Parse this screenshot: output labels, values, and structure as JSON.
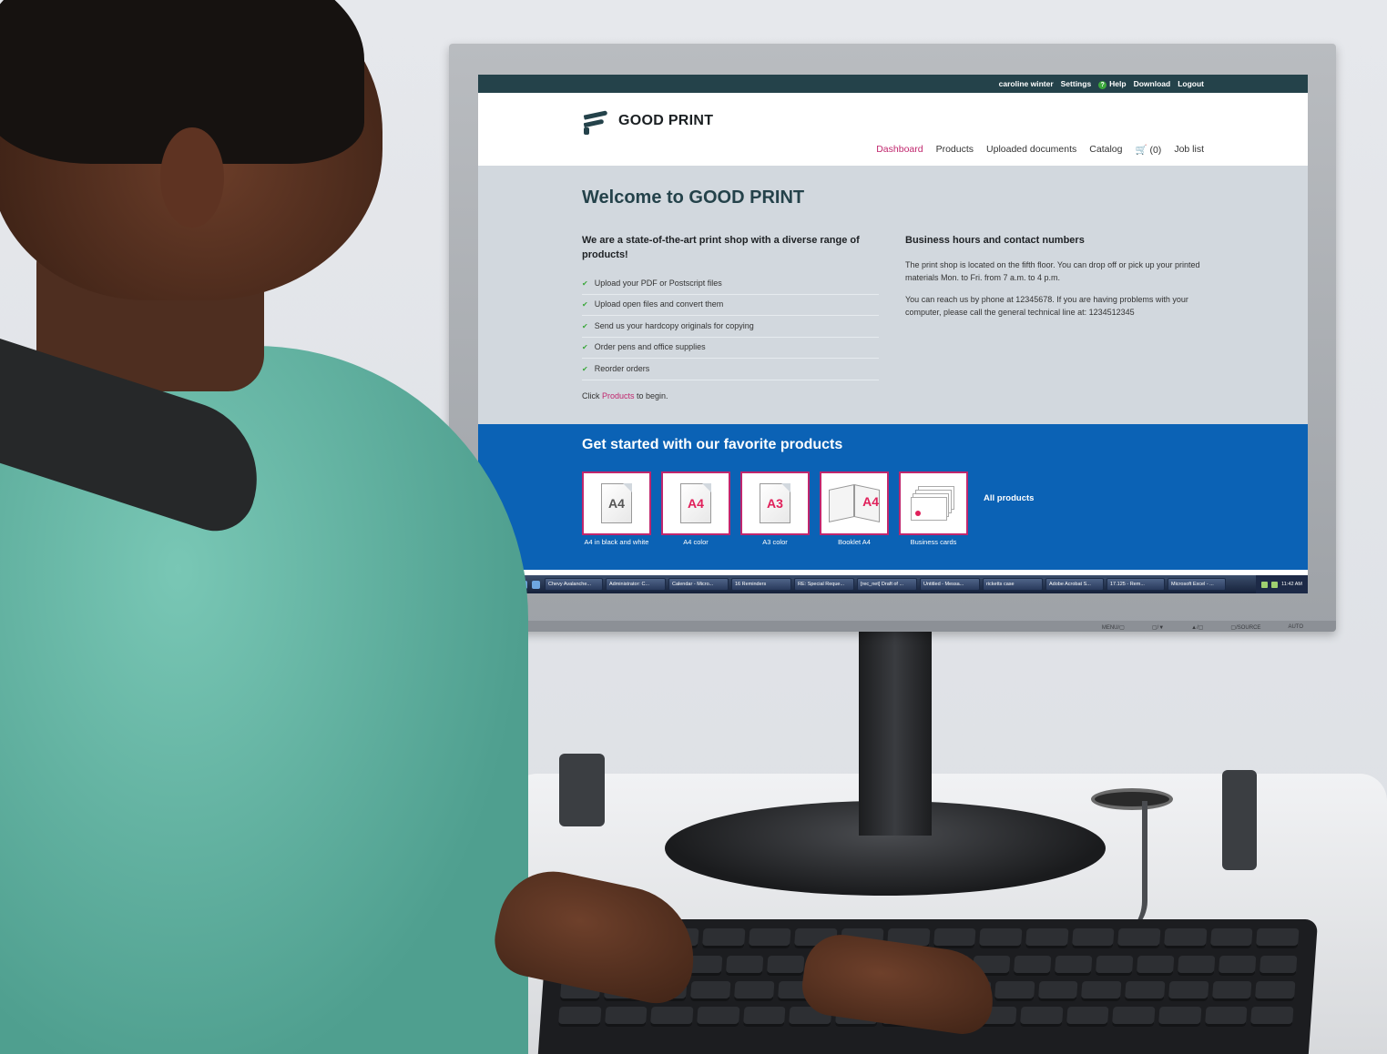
{
  "topbar": {
    "user": "caroline winter",
    "settings": "Settings",
    "help": "Help",
    "help_glyph": "?",
    "download": "Download",
    "logout": "Logout"
  },
  "logo": {
    "text": "GOOD PRINT"
  },
  "nav": {
    "dashboard": "Dashboard",
    "products": "Products",
    "uploaded": "Uploaded documents",
    "catalog": "Catalog",
    "cart": "(0)",
    "joblist": "Job list"
  },
  "welcome": {
    "title": "Welcome to GOOD PRINT",
    "left_heading": "We are a state-of-the-art print shop with a diverse range of products!",
    "features": [
      "Upload your PDF or Postscript files",
      "Upload open files and convert them",
      "Send us your hardcopy originals for copying",
      "Order pens and office supplies",
      "Reorder orders"
    ],
    "click_prefix": "Click ",
    "click_link": "Products",
    "click_suffix": " to begin.",
    "right_heading": "Business hours and contact numbers",
    "hours_text": "The print shop is located on the fifth floor. You can drop off or pick up your printed materials Mon. to Fri. from 7 a.m. to 4 p.m.",
    "contact_text": "You can reach us by phone at 12345678. If you are having problems with your computer, please call the general technical line at: 1234512345"
  },
  "favorites": {
    "heading": "Get started with our favorite products",
    "items": [
      {
        "icon_text": "A4",
        "caption": "A4 in black and white"
      },
      {
        "icon_text": "A4",
        "caption": "A4 color"
      },
      {
        "icon_text": "A3",
        "caption": "A3 color"
      },
      {
        "icon_text": "A4",
        "caption": "Booklet A4"
      },
      {
        "icon_text": "",
        "caption": "Business cards"
      }
    ],
    "all_products": "All products"
  },
  "taskbar": {
    "items": [
      "Chevy Avalanche...",
      "Administrator: C...",
      "Calendar - Micro...",
      "16 Reminders",
      "RE: Special Reque...",
      "[rec_net] Draft of ...",
      "Untitled - Messa...",
      "ricketts case",
      "Adobe Acrobat S...",
      "17.125 - Rem...",
      "Microsoft Excel - ..."
    ],
    "clock": "11:42 AM"
  },
  "monitor": {
    "buttons": [
      "MENU/▢",
      "▢/▼",
      "▲/▢",
      "▢/SOURCE",
      "AUTO"
    ]
  },
  "colors": {
    "topbar": "#24424a",
    "accent": "#c0266d",
    "favorites_bg": "#0b62b5",
    "check": "#3ca83c"
  }
}
